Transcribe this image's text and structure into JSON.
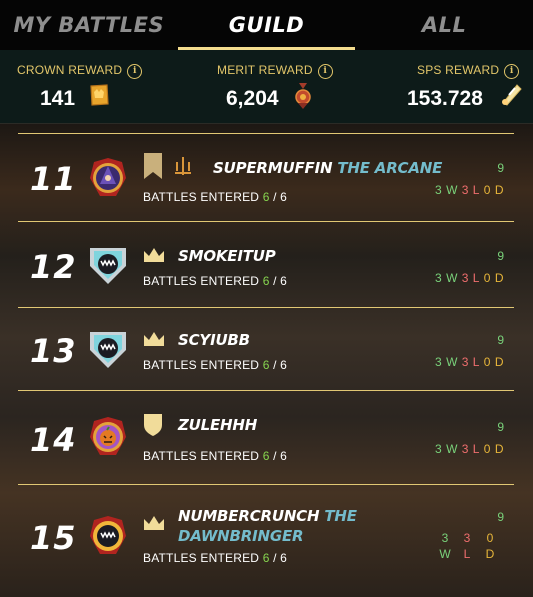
{
  "tabs": [
    {
      "label": "MY BATTLES",
      "active": false
    },
    {
      "label": "GUILD",
      "active": true
    },
    {
      "label": "ALL",
      "active": false
    }
  ],
  "rewards": {
    "crown": {
      "label": "CROWN REWARD",
      "value": "141",
      "icon": "crown-token-icon"
    },
    "merit": {
      "label": "MERIT REWARD",
      "value": "6,204",
      "icon": "merit-medal-icon"
    },
    "sps": {
      "label": "SPS REWARD",
      "value": "153.728",
      "icon": "sps-token-icon"
    },
    "info_glyph": "i"
  },
  "entered_label": "BATTLES ENTERED",
  "players": [
    {
      "rank": "11",
      "name": "SUPERMUFFIN",
      "title": "THE ARCANE",
      "entered": "6",
      "total": "6",
      "battles": "9",
      "w": "3",
      "w_suffix": "W",
      "l": "3",
      "l_suffix": "L",
      "d": "0",
      "d_suffix": "D",
      "avatar": "wizard-avatar",
      "badges": [
        "banner-icon",
        "guild-emblem-icon"
      ]
    },
    {
      "rank": "12",
      "name": "SMOKEITUP",
      "title": "",
      "entered": "6",
      "total": "6",
      "battles": "9",
      "w": "3",
      "w_suffix": "W",
      "l": "3",
      "l_suffix": "L",
      "d": "0",
      "d_suffix": "D",
      "avatar": "monster-avatar",
      "badges": [
        "crown-icon"
      ]
    },
    {
      "rank": "13",
      "name": "SCYIUBB",
      "title": "",
      "entered": "6",
      "total": "6",
      "battles": "9",
      "w": "3",
      "w_suffix": "W",
      "l": "3",
      "l_suffix": "L",
      "d": "0",
      "d_suffix": "D",
      "avatar": "monster-avatar",
      "badges": [
        "crown-icon"
      ]
    },
    {
      "rank": "14",
      "name": "ZULEHHH",
      "title": "",
      "entered": "6",
      "total": "6",
      "battles": "9",
      "w": "3",
      "w_suffix": "W",
      "l": "3",
      "l_suffix": "L",
      "d": "0",
      "d_suffix": "D",
      "avatar": "pumpkin-avatar",
      "badges": [
        "shield-icon"
      ]
    },
    {
      "rank": "15",
      "name": "NUMBERCRUNCH",
      "title": "THE DAWNBRINGER",
      "entered": "6",
      "total": "6",
      "battles": "9",
      "w": "3",
      "w_suffix": "W",
      "l": "3",
      "l_suffix": "L",
      "d": "0",
      "d_suffix": "D",
      "avatar": "monster-avatar",
      "badges": [
        "crown-icon"
      ]
    }
  ],
  "colors": {
    "accent": "#e1c874",
    "win": "#79d17a",
    "loss": "#ef6e6e",
    "draw": "#e7b63a",
    "title": "#74bccc"
  }
}
